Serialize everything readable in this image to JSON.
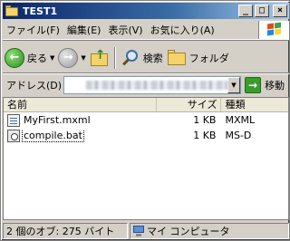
{
  "window": {
    "title": "TEST1",
    "controls": {
      "minimize": "_",
      "maximize": "□",
      "close": "×"
    }
  },
  "menu": {
    "items": [
      "ファイル(F)",
      "編集(E)",
      "表示(V)",
      "お気に入り(A)"
    ]
  },
  "toolbar": {
    "back_label": "戻る",
    "back_arrow": "←",
    "forward_arrow": "→",
    "up_arrow": "↑",
    "search_label": "検索",
    "folders_label": "フォルダ",
    "dropdown_glyph": "▼"
  },
  "address": {
    "label": "アドレス(D)",
    "go_label": "移動",
    "go_arrow": "→"
  },
  "list": {
    "columns": {
      "name": "名前",
      "size": "サイズ",
      "type": "種類"
    },
    "files": [
      {
        "name": "MyFirst.mxml",
        "size": "1 KB",
        "type": "MXML"
      },
      {
        "name": "compile.bat",
        "size": "1 KB",
        "type": "MS-D"
      }
    ]
  },
  "status": {
    "left": "2 個のオブ: 275 バイト",
    "right": "マイ コンピュータ"
  }
}
